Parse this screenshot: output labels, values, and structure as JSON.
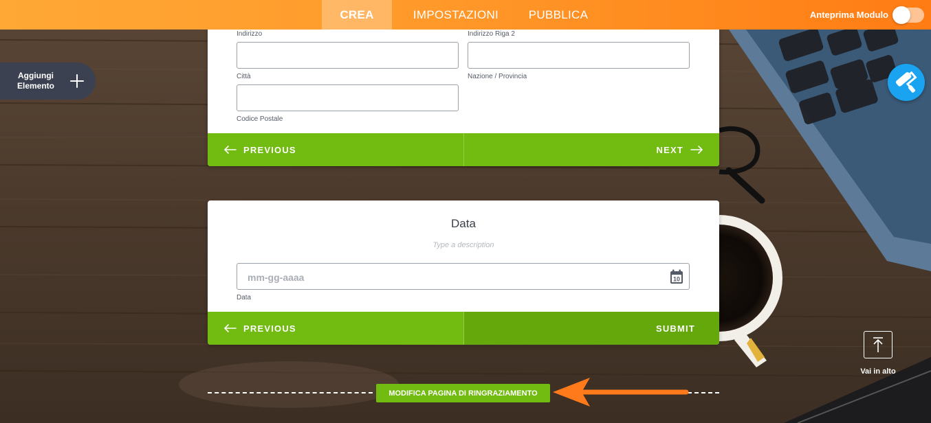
{
  "topbar": {
    "tabs": [
      {
        "label": "CREA",
        "active": true
      },
      {
        "label": "IMPOSTAZIONI",
        "active": false
      },
      {
        "label": "PUBBLICA",
        "active": false
      }
    ],
    "preview_label": "Anteprima Modulo",
    "preview_enabled": false
  },
  "add_element": {
    "label_line1": "Aggiungi",
    "label_line2": "Elemento"
  },
  "address_card": {
    "labels": {
      "address": "Indirizzo",
      "address2": "Indirizzo Riga 2",
      "city": "Città",
      "state": "Nazione / Provincia",
      "zip": "Codice Postale"
    },
    "prev_label": "PREVIOUS",
    "next_label": "NEXT"
  },
  "date_card": {
    "title": "Data",
    "description": "Type a description",
    "placeholder": "mm-gg-aaaa",
    "sublabel": "Data",
    "calendar_day": "10",
    "prev_label": "PREVIOUS",
    "submit_label": "SUBMIT"
  },
  "thank_you": {
    "label": "MODIFICA PAGINA DI RINGRAZIAMENTO"
  },
  "scroll_top": {
    "label": "Vai in alto"
  },
  "colors": {
    "accent_orange": "#ff8a1f",
    "button_green": "#72bb10",
    "designer_blue": "#1aa3f0",
    "add_element_bg": "#3b4150"
  },
  "icons": {
    "designer": "paint-roller-icon",
    "add": "plus-icon",
    "calendar": "calendar-icon",
    "prev": "arrow-left-icon",
    "next": "arrow-right-icon",
    "scroll_top": "arrow-up-icon",
    "annotation": "arrow-annotation-icon"
  }
}
